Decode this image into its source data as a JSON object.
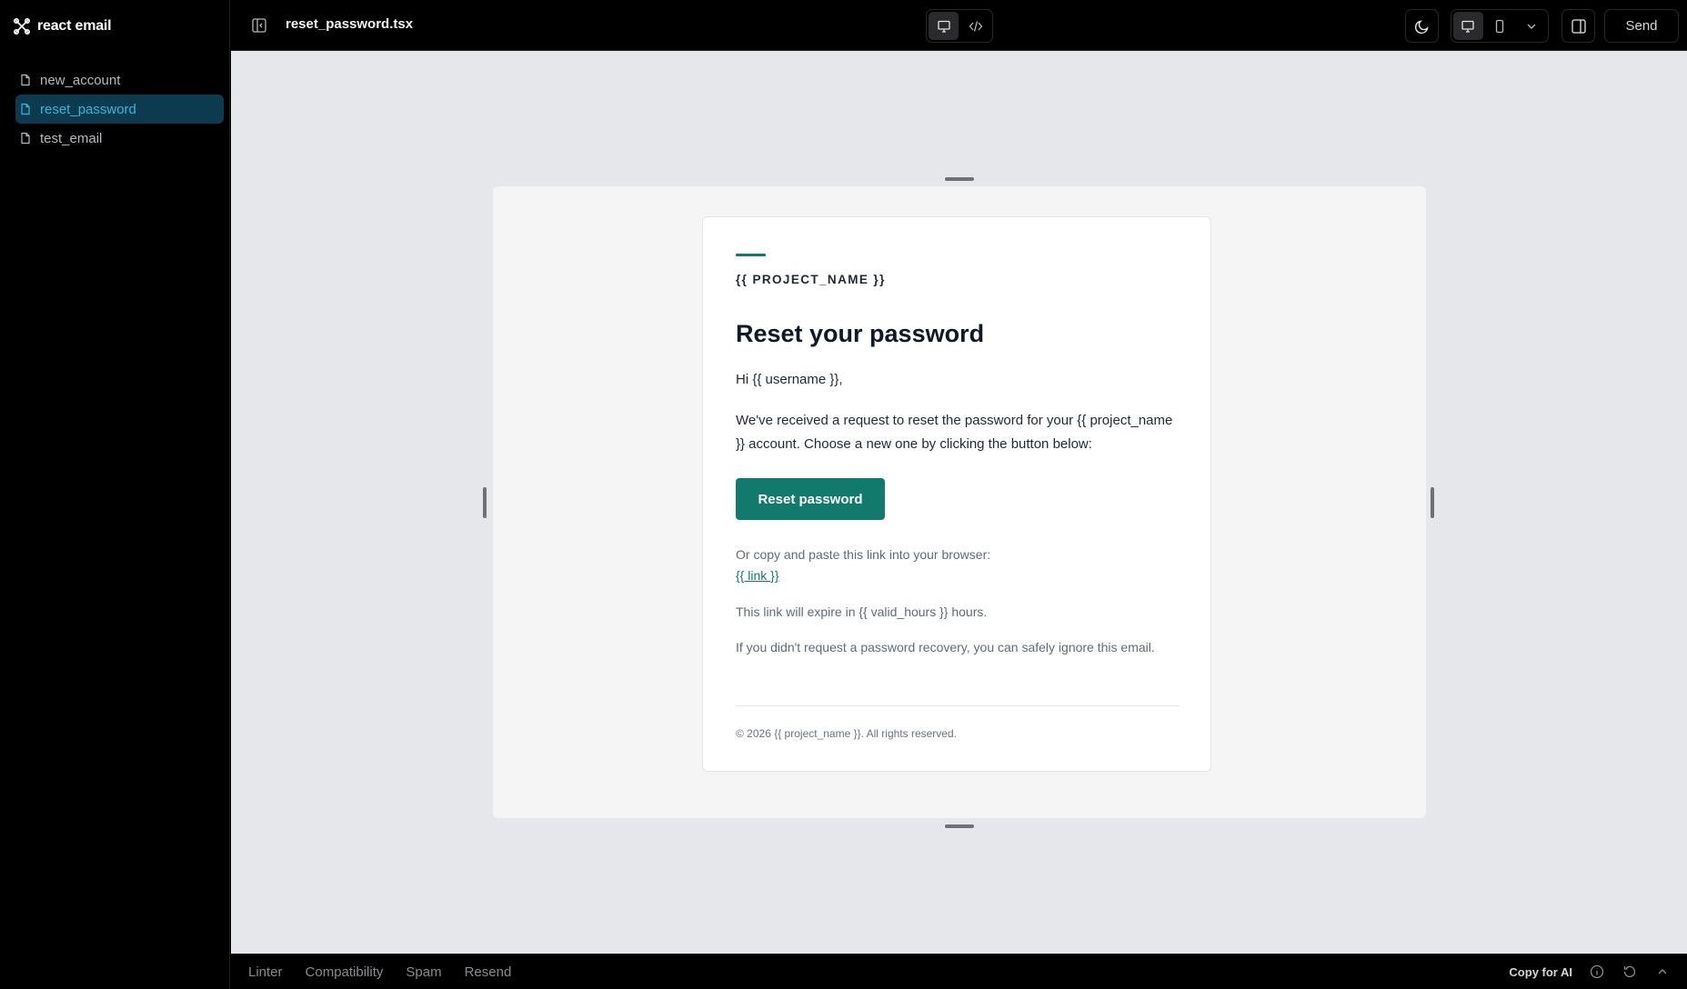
{
  "app": {
    "name": "react email",
    "file_title": "reset_password.tsx"
  },
  "sidebar": {
    "items": [
      {
        "label": "new_account",
        "active": false
      },
      {
        "label": "reset_password",
        "active": true
      },
      {
        "label": "test_email",
        "active": false
      }
    ]
  },
  "toolbar": {
    "send_label": "Send",
    "view_modes": [
      "desktop-preview-icon",
      "code-icon"
    ],
    "active_view": "desktop-preview-icon",
    "device_modes": [
      "desktop-icon",
      "mobile-icon"
    ],
    "active_device": "desktop-icon"
  },
  "email": {
    "project_name": "{{ PROJECT_NAME }}",
    "heading": "Reset your password",
    "greeting": "Hi {{ username }},",
    "body": "We've received a request to reset the password for your {{ project_name }} account. Choose a new one by clicking the button below:",
    "button_label": "Reset password",
    "copy_text": "Or copy and paste this link into your browser:",
    "link_text": "{{ link }}",
    "expire_text": "This link will expire in {{ valid_hours }} hours.",
    "ignore_text": "If you didn't request a password recovery, you can safely ignore this email.",
    "footer": "© 2026 {{ project_name }}. All rights reserved."
  },
  "bottombar": {
    "tabs": [
      "Linter",
      "Compatibility",
      "Spam",
      "Resend"
    ],
    "copy_ai_label": "Copy for AI"
  },
  "colors": {
    "accent": "#117a6d",
    "active_nav_bg": "#0c3b50",
    "active_nav_text": "#3bb4d8",
    "canvas_bg": "#e6e7ea"
  }
}
